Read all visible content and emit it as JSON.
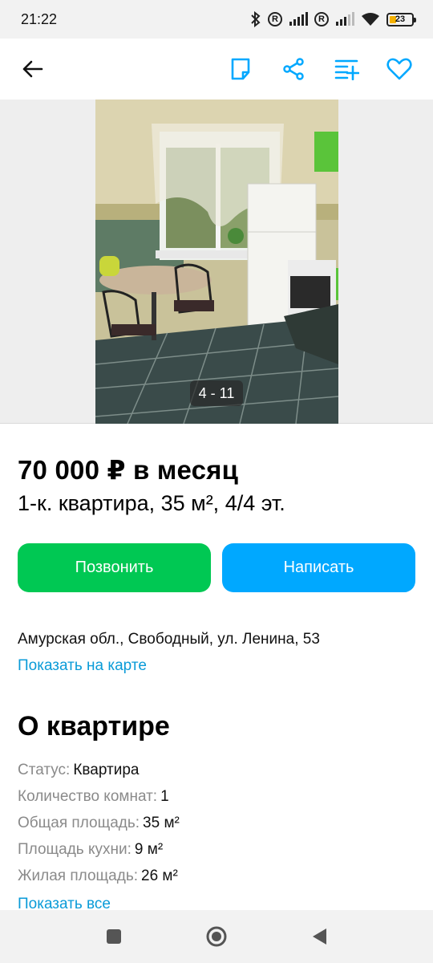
{
  "status_bar": {
    "time": "21:22",
    "battery": "23",
    "icons": [
      "bluetooth-icon",
      "registered-icon",
      "signal-icon",
      "registered-icon",
      "signal-icon",
      "wifi-icon",
      "battery-icon"
    ]
  },
  "app_bar": {
    "icons": [
      "back-arrow-icon",
      "note-icon",
      "share-icon",
      "compare-icon",
      "heart-icon"
    ],
    "accent_color": "#00a8ff"
  },
  "gallery": {
    "counter": "4 - 11"
  },
  "listing": {
    "price": "70 000 ₽ в месяц",
    "subtitle": "1-к. квартира, 35 м², 4/4 эт.",
    "call_label": "Позвонить",
    "message_label": "Написать",
    "call_color": "#00c853",
    "message_color": "#00a8ff",
    "address": "Амурская обл., Свободный, ул. Ленина, 53",
    "map_link": "Показать на карте"
  },
  "about": {
    "title": "О квартире",
    "params": [
      {
        "key": "Статус:",
        "value": "Квартира"
      },
      {
        "key": "Количество комнат:",
        "value": "1"
      },
      {
        "key": "Общая площадь:",
        "value": "35 м²"
      },
      {
        "key": "Площадь кухни:",
        "value": "9 м²"
      },
      {
        "key": "Жилая площадь:",
        "value": "26 м²"
      }
    ],
    "show_all": "Показать все"
  },
  "nav_bar": {
    "icons": [
      "recents-square-icon",
      "home-circle-icon",
      "back-triangle-icon"
    ]
  }
}
